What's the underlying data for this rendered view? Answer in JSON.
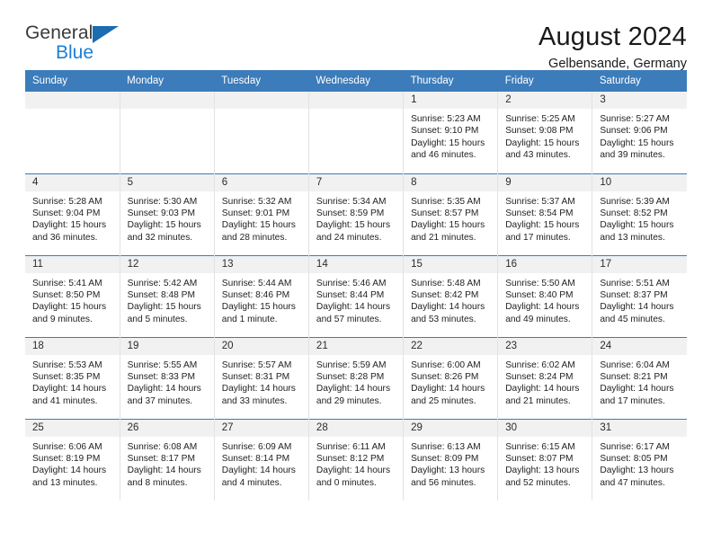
{
  "logo": {
    "primary_text": "General",
    "secondary_text": "Blue",
    "primary_color": "#3a3a3a",
    "secondary_color": "#1b7fd4",
    "triangle_color": "#1b6cb0"
  },
  "header": {
    "title": "August 2024",
    "location": "Gelbensande, Germany"
  },
  "theme": {
    "header_row_bg": "#3c7cba",
    "daynum_bg": "#f1f1f1",
    "row_separator": "#3c7cba",
    "cell_divider": "#e2e2e2"
  },
  "calendar": {
    "weekday_headers": [
      "Sunday",
      "Monday",
      "Tuesday",
      "Wednesday",
      "Thursday",
      "Friday",
      "Saturday"
    ],
    "weeks": [
      [
        {
          "day": "",
          "empty": true
        },
        {
          "day": "",
          "empty": true
        },
        {
          "day": "",
          "empty": true
        },
        {
          "day": "",
          "empty": true
        },
        {
          "day": "1",
          "sunrise": "Sunrise: 5:23 AM",
          "sunset": "Sunset: 9:10 PM",
          "daylight_1": "Daylight: 15 hours",
          "daylight_2": "and 46 minutes."
        },
        {
          "day": "2",
          "sunrise": "Sunrise: 5:25 AM",
          "sunset": "Sunset: 9:08 PM",
          "daylight_1": "Daylight: 15 hours",
          "daylight_2": "and 43 minutes."
        },
        {
          "day": "3",
          "sunrise": "Sunrise: 5:27 AM",
          "sunset": "Sunset: 9:06 PM",
          "daylight_1": "Daylight: 15 hours",
          "daylight_2": "and 39 minutes."
        }
      ],
      [
        {
          "day": "4",
          "sunrise": "Sunrise: 5:28 AM",
          "sunset": "Sunset: 9:04 PM",
          "daylight_1": "Daylight: 15 hours",
          "daylight_2": "and 36 minutes."
        },
        {
          "day": "5",
          "sunrise": "Sunrise: 5:30 AM",
          "sunset": "Sunset: 9:03 PM",
          "daylight_1": "Daylight: 15 hours",
          "daylight_2": "and 32 minutes."
        },
        {
          "day": "6",
          "sunrise": "Sunrise: 5:32 AM",
          "sunset": "Sunset: 9:01 PM",
          "daylight_1": "Daylight: 15 hours",
          "daylight_2": "and 28 minutes."
        },
        {
          "day": "7",
          "sunrise": "Sunrise: 5:34 AM",
          "sunset": "Sunset: 8:59 PM",
          "daylight_1": "Daylight: 15 hours",
          "daylight_2": "and 24 minutes."
        },
        {
          "day": "8",
          "sunrise": "Sunrise: 5:35 AM",
          "sunset": "Sunset: 8:57 PM",
          "daylight_1": "Daylight: 15 hours",
          "daylight_2": "and 21 minutes."
        },
        {
          "day": "9",
          "sunrise": "Sunrise: 5:37 AM",
          "sunset": "Sunset: 8:54 PM",
          "daylight_1": "Daylight: 15 hours",
          "daylight_2": "and 17 minutes."
        },
        {
          "day": "10",
          "sunrise": "Sunrise: 5:39 AM",
          "sunset": "Sunset: 8:52 PM",
          "daylight_1": "Daylight: 15 hours",
          "daylight_2": "and 13 minutes."
        }
      ],
      [
        {
          "day": "11",
          "sunrise": "Sunrise: 5:41 AM",
          "sunset": "Sunset: 8:50 PM",
          "daylight_1": "Daylight: 15 hours",
          "daylight_2": "and 9 minutes."
        },
        {
          "day": "12",
          "sunrise": "Sunrise: 5:42 AM",
          "sunset": "Sunset: 8:48 PM",
          "daylight_1": "Daylight: 15 hours",
          "daylight_2": "and 5 minutes."
        },
        {
          "day": "13",
          "sunrise": "Sunrise: 5:44 AM",
          "sunset": "Sunset: 8:46 PM",
          "daylight_1": "Daylight: 15 hours",
          "daylight_2": "and 1 minute."
        },
        {
          "day": "14",
          "sunrise": "Sunrise: 5:46 AM",
          "sunset": "Sunset: 8:44 PM",
          "daylight_1": "Daylight: 14 hours",
          "daylight_2": "and 57 minutes."
        },
        {
          "day": "15",
          "sunrise": "Sunrise: 5:48 AM",
          "sunset": "Sunset: 8:42 PM",
          "daylight_1": "Daylight: 14 hours",
          "daylight_2": "and 53 minutes."
        },
        {
          "day": "16",
          "sunrise": "Sunrise: 5:50 AM",
          "sunset": "Sunset: 8:40 PM",
          "daylight_1": "Daylight: 14 hours",
          "daylight_2": "and 49 minutes."
        },
        {
          "day": "17",
          "sunrise": "Sunrise: 5:51 AM",
          "sunset": "Sunset: 8:37 PM",
          "daylight_1": "Daylight: 14 hours",
          "daylight_2": "and 45 minutes."
        }
      ],
      [
        {
          "day": "18",
          "sunrise": "Sunrise: 5:53 AM",
          "sunset": "Sunset: 8:35 PM",
          "daylight_1": "Daylight: 14 hours",
          "daylight_2": "and 41 minutes."
        },
        {
          "day": "19",
          "sunrise": "Sunrise: 5:55 AM",
          "sunset": "Sunset: 8:33 PM",
          "daylight_1": "Daylight: 14 hours",
          "daylight_2": "and 37 minutes."
        },
        {
          "day": "20",
          "sunrise": "Sunrise: 5:57 AM",
          "sunset": "Sunset: 8:31 PM",
          "daylight_1": "Daylight: 14 hours",
          "daylight_2": "and 33 minutes."
        },
        {
          "day": "21",
          "sunrise": "Sunrise: 5:59 AM",
          "sunset": "Sunset: 8:28 PM",
          "daylight_1": "Daylight: 14 hours",
          "daylight_2": "and 29 minutes."
        },
        {
          "day": "22",
          "sunrise": "Sunrise: 6:00 AM",
          "sunset": "Sunset: 8:26 PM",
          "daylight_1": "Daylight: 14 hours",
          "daylight_2": "and 25 minutes."
        },
        {
          "day": "23",
          "sunrise": "Sunrise: 6:02 AM",
          "sunset": "Sunset: 8:24 PM",
          "daylight_1": "Daylight: 14 hours",
          "daylight_2": "and 21 minutes."
        },
        {
          "day": "24",
          "sunrise": "Sunrise: 6:04 AM",
          "sunset": "Sunset: 8:21 PM",
          "daylight_1": "Daylight: 14 hours",
          "daylight_2": "and 17 minutes."
        }
      ],
      [
        {
          "day": "25",
          "sunrise": "Sunrise: 6:06 AM",
          "sunset": "Sunset: 8:19 PM",
          "daylight_1": "Daylight: 14 hours",
          "daylight_2": "and 13 minutes."
        },
        {
          "day": "26",
          "sunrise": "Sunrise: 6:08 AM",
          "sunset": "Sunset: 8:17 PM",
          "daylight_1": "Daylight: 14 hours",
          "daylight_2": "and 8 minutes."
        },
        {
          "day": "27",
          "sunrise": "Sunrise: 6:09 AM",
          "sunset": "Sunset: 8:14 PM",
          "daylight_1": "Daylight: 14 hours",
          "daylight_2": "and 4 minutes."
        },
        {
          "day": "28",
          "sunrise": "Sunrise: 6:11 AM",
          "sunset": "Sunset: 8:12 PM",
          "daylight_1": "Daylight: 14 hours",
          "daylight_2": "and 0 minutes."
        },
        {
          "day": "29",
          "sunrise": "Sunrise: 6:13 AM",
          "sunset": "Sunset: 8:09 PM",
          "daylight_1": "Daylight: 13 hours",
          "daylight_2": "and 56 minutes."
        },
        {
          "day": "30",
          "sunrise": "Sunrise: 6:15 AM",
          "sunset": "Sunset: 8:07 PM",
          "daylight_1": "Daylight: 13 hours",
          "daylight_2": "and 52 minutes."
        },
        {
          "day": "31",
          "sunrise": "Sunrise: 6:17 AM",
          "sunset": "Sunset: 8:05 PM",
          "daylight_1": "Daylight: 13 hours",
          "daylight_2": "and 47 minutes."
        }
      ]
    ]
  }
}
